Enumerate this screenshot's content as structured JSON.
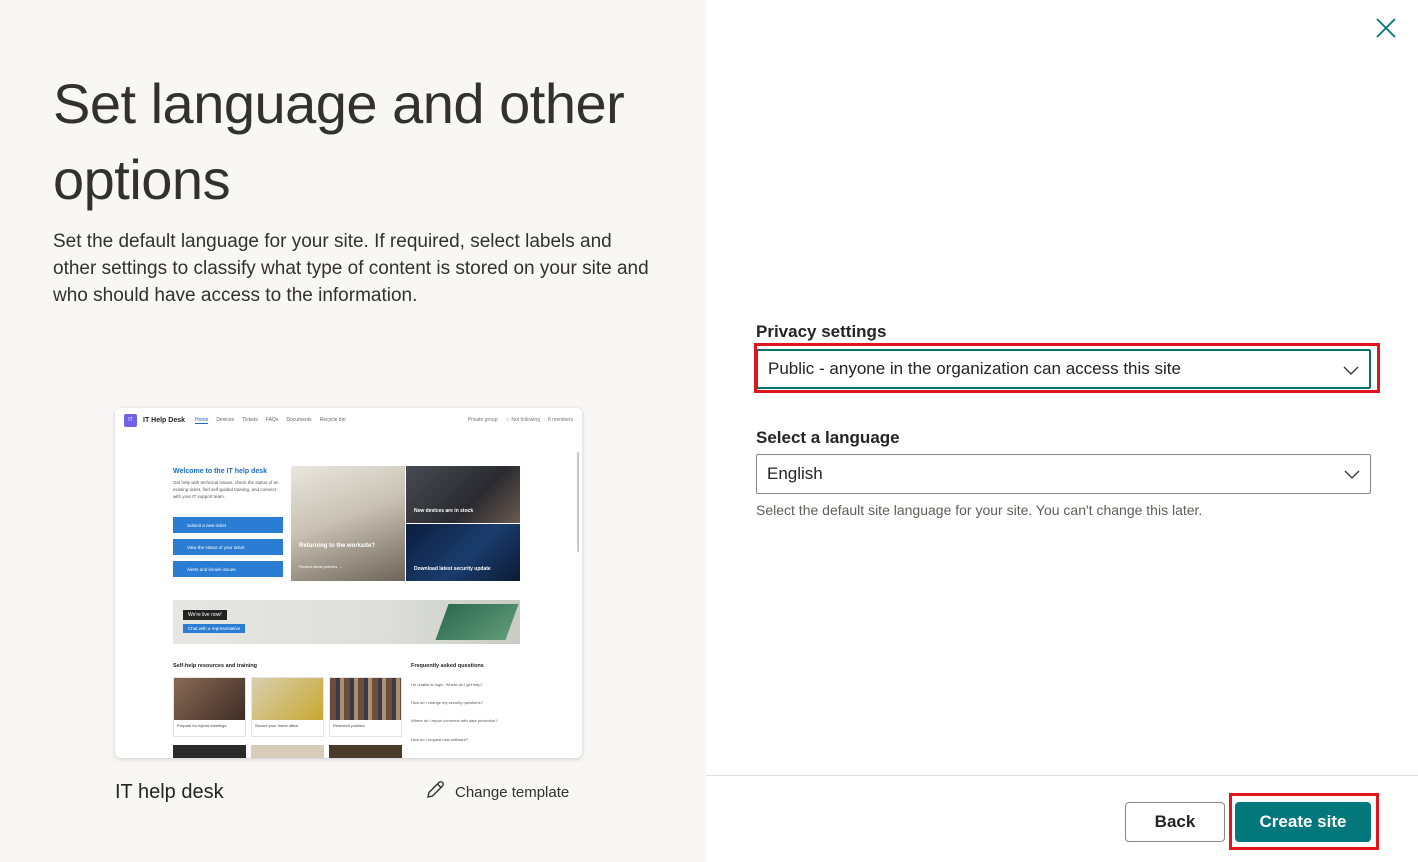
{
  "left": {
    "title": "Set language and other options",
    "description": "Set the default language for your site. If required, select labels and other settings to classify what type of content is stored on your site and who should have access to the information.",
    "template_name": "IT help desk",
    "change_template_label": "Change template"
  },
  "preview": {
    "logo": "IT",
    "site_name": "IT Help Desk",
    "nav": [
      "Home",
      "Devices",
      "Tickets",
      "FAQs",
      "Documents",
      "Recycle bin"
    ],
    "right": [
      "Private group",
      "☆ Not following",
      "8 members"
    ],
    "welcome_title": "Welcome to the IT help desk",
    "welcome_text": "Get help with technical issues, check the status of an existing ticket, find self-guided training, and connect with your IT support team.",
    "buttons": [
      "Submit a new ticket",
      "View the status of your ticket",
      "Alerts and known issues"
    ],
    "hero": {
      "main_title": "Returning to the worksite?",
      "main_link": "Review latest policies →",
      "tile1": "New devices are in stock",
      "tile2": "Download latest security update"
    },
    "banner": {
      "live": "We're live now!",
      "chat": "Chat with a representative"
    },
    "resources_heading": "Self-help resources and training",
    "resources": [
      "Prepare for hybrid meetings",
      "Secure your home office",
      "Research policies"
    ],
    "faq_heading": "Frequently asked questions",
    "faqs": [
      "I'm unable to login. Where do I get help?",
      "How do I change my security questions?",
      "Where do I report concerns with data protection?",
      "How do I request new software?"
    ]
  },
  "privacy": {
    "label": "Privacy settings",
    "value": "Public - anyone in the organization can access this site"
  },
  "language": {
    "label": "Select a language",
    "value": "English",
    "help": "Select the default site language for your site. You can't change this later."
  },
  "footer": {
    "back_label": "Back",
    "create_label": "Create site"
  },
  "colors": {
    "accent": "#03787c",
    "highlight": "#e0161d",
    "left_bg": "#f8f7f6"
  }
}
